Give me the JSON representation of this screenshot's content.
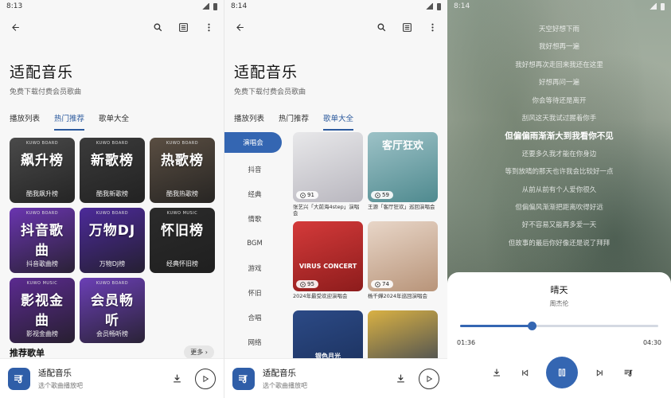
{
  "screen1": {
    "status_time": "8:13",
    "title": "适配音乐",
    "subtitle": "免费下载付费会员歌曲",
    "tabs": [
      {
        "label": "播放列表",
        "active": false
      },
      {
        "label": "热门推荐",
        "active": true
      },
      {
        "label": "歌单大全",
        "active": false
      }
    ],
    "charts": [
      {
        "title": "飙升榜",
        "caption": "酷我飙升榜",
        "badge": "KUWO BOARD",
        "color": "#4a4a4a"
      },
      {
        "title": "新歌榜",
        "caption": "酷我新歌榜",
        "badge": "KUWO BOARD",
        "color": "#3b3b3b"
      },
      {
        "title": "热歌榜",
        "caption": "酷我热歌榜",
        "badge": "KUWO BOARD",
        "color": "#5a4e42"
      },
      {
        "title": "抖音歌曲",
        "caption": "抖音歌曲榜",
        "badge": "KUWO BOARD",
        "color": "#6a35b0"
      },
      {
        "title": "万物DJ",
        "caption": "万物DJ榜",
        "badge": "KUWO BOARD",
        "color": "#4c2a9a"
      },
      {
        "title": "怀旧榜",
        "caption": "经典怀旧榜",
        "badge": "KUWO MUSIC",
        "color": "#2b2b2b"
      },
      {
        "title": "影视金曲",
        "caption": "影视金曲榜",
        "badge": "KUWO MUSIC",
        "color": "#5b2a90"
      },
      {
        "title": "会员畅听",
        "caption": "会员畅听榜",
        "badge": "KUWO BOARD",
        "color": "#6b3fb6"
      }
    ],
    "section_title": "推荐歌单",
    "more_label": "更多 ›"
  },
  "screen2": {
    "status_time": "8:14",
    "title": "适配音乐",
    "subtitle": "免费下载付费会员歌曲",
    "tabs": [
      {
        "label": "播放列表",
        "active": false
      },
      {
        "label": "热门推荐",
        "active": false
      },
      {
        "label": "歌单大全",
        "active": true
      }
    ],
    "categories": [
      {
        "label": "演唱会",
        "active": true
      },
      {
        "label": "抖音",
        "active": false
      },
      {
        "label": "经典",
        "active": false
      },
      {
        "label": "情歌",
        "active": false
      },
      {
        "label": "BGM",
        "active": false
      },
      {
        "label": "游戏",
        "active": false
      },
      {
        "label": "怀旧",
        "active": false
      },
      {
        "label": "合唱",
        "active": false
      },
      {
        "label": "网络",
        "active": false
      }
    ],
    "playlists": [
      {
        "count": "91",
        "name": "张艺兴「大前海4step」演唱会",
        "cover_text": "",
        "colors": [
          "#e8e8ea",
          "#b9b7bf"
        ]
      },
      {
        "count": "59",
        "name": "王源「客厅狂欢」巡回演唱会",
        "cover_text": "客厅狂欢",
        "colors": [
          "#9dc2c7",
          "#4f8a8f"
        ]
      },
      {
        "count": "95",
        "name": "2024年最受欢迎演唱会",
        "cover_text": "VIRUS CONCERT",
        "colors": [
          "#d43a3a",
          "#8d1c1c"
        ]
      },
      {
        "count": "74",
        "name": "杨千嬅2024年巡回演唱会",
        "cover_text": "",
        "colors": [
          "#e8d6c8",
          "#b89479"
        ]
      },
      {
        "count": "",
        "name": "",
        "cover_text": "银色月光",
        "colors": [
          "#2c4a86",
          "#1a2f5a"
        ]
      },
      {
        "count": "",
        "name": "",
        "cover_text": "",
        "colors": [
          "#d9b143",
          "#2f3c55"
        ]
      }
    ]
  },
  "mini_player": {
    "title": "适配音乐",
    "subtitle": "选个歌曲播放吧"
  },
  "screen3": {
    "status_time": "8:14",
    "lyrics": [
      "天空好想下雨",
      "我好想再一遍",
      "我好想再次走回来我还在这里",
      "好想再问一遍",
      "你会等待还是离开",
      "刮风这天我试过握着你手",
      "但偏偏雨渐渐大到我看你不见",
      "还要多久我才能在你身边",
      "等到放晴的那天也许我会比较好一点",
      "从前从前有个人爱你很久",
      "但偏偏风渐渐把距离吹得好远",
      "好不容易又能再多爱一天",
      "但故事的最后你好像还是说了拜拜"
    ],
    "current_lyric_index": 6,
    "song_title": "晴天",
    "artist": "周杰伦",
    "elapsed": "01:36",
    "duration": "04:30",
    "progress": 0.36
  },
  "colors": {
    "accent": "#3466b2",
    "mini_player_icon": "#2f5ea8"
  },
  "icons": {
    "back": "arrow-back-icon",
    "search": "search-icon",
    "list": "list-icon",
    "more": "more-vert-icon",
    "download": "download-icon",
    "play": "play-icon",
    "pause": "pause-icon",
    "prev": "skip-previous-icon",
    "next": "skip-next-icon",
    "queue": "queue-icon"
  }
}
